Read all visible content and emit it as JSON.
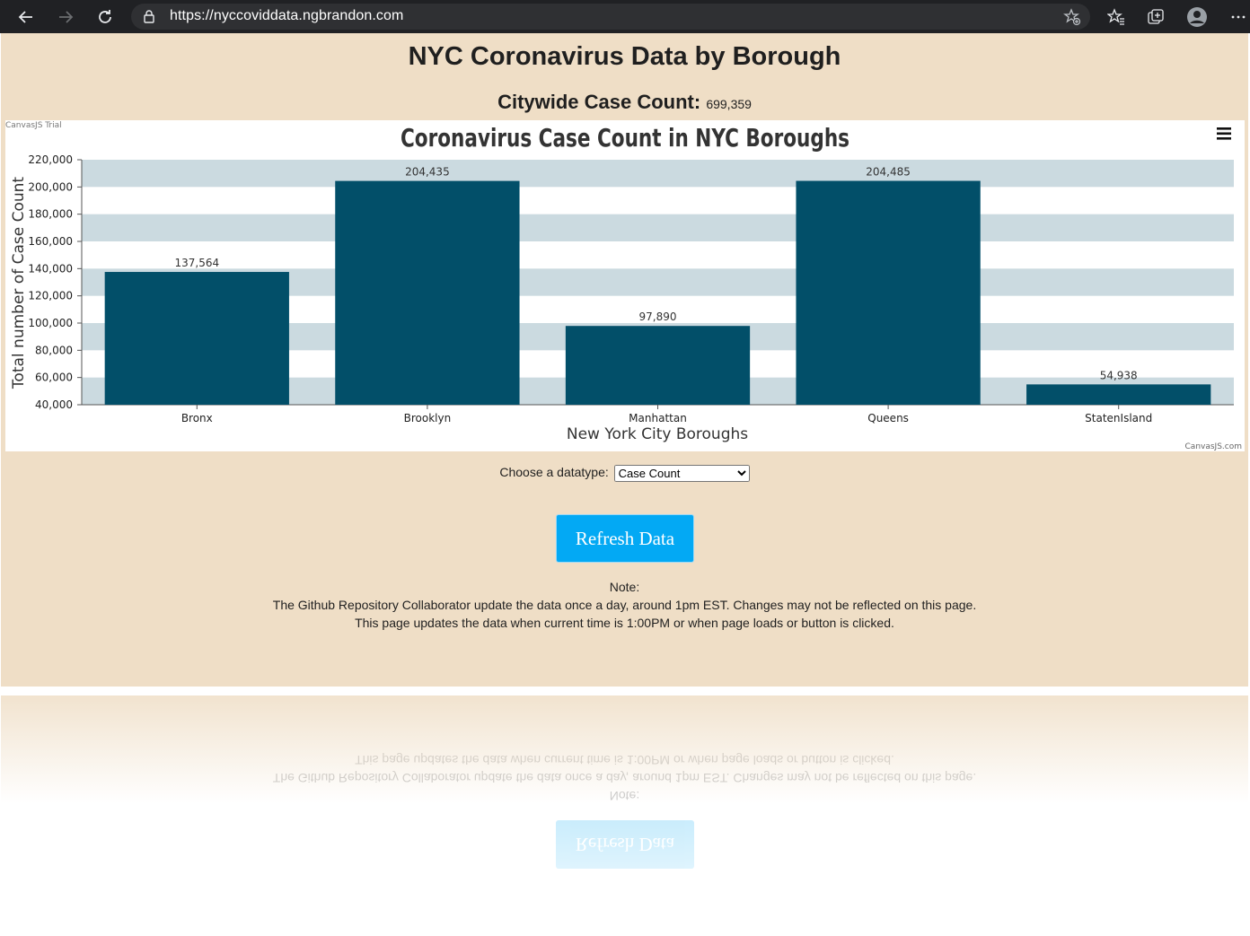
{
  "browser": {
    "url": "https://nyccoviddata.ngbrandon.com"
  },
  "page": {
    "title": "NYC Coronavirus Data by Borough",
    "citywide_label": "Citywide Case Count:",
    "citywide_value": "699,359",
    "datatype_label": "Choose a datatype:",
    "datatype_selected": "Case Count",
    "refresh_button": "Refresh Data",
    "note_heading": "Note:",
    "note_line1": "The Github Repository Collaborator update the data once a day, around 1pm EST. Changes may not be reflected on this page.",
    "note_line2": "This page updates the data when current time is 1:00PM or when page loads or button is clicked."
  },
  "chart_data": {
    "type": "bar",
    "title": "Coronavirus Case Count in NYC Boroughs",
    "xlabel": "New York City Boroughs",
    "ylabel": "Total number of Case Count",
    "categories": [
      "Bronx",
      "Brooklyn",
      "Manhattan",
      "Queens",
      "StatenIsland"
    ],
    "values": [
      137564,
      204435,
      97890,
      204485,
      54938
    ],
    "value_labels": [
      "137,564",
      "204,435",
      "97,890",
      "204,485",
      "54,938"
    ],
    "ylim": [
      40000,
      220000
    ],
    "yticks": [
      40000,
      60000,
      80000,
      100000,
      120000,
      140000,
      160000,
      180000,
      200000,
      220000
    ],
    "ytick_labels": [
      "40,000",
      "60,000",
      "80,000",
      "100,000",
      "120,000",
      "140,000",
      "160,000",
      "180,000",
      "200,000",
      "220,000"
    ],
    "grid": "alternating bands",
    "bar_color": "#024f69",
    "band_color": "#cbdae0",
    "trial_label": "CanvasJS Trial",
    "credit": "CanvasJS.com"
  },
  "colors": {
    "page_bg": "#efdec6",
    "button_bg": "#03a9f4",
    "chrome_bg": "#202124"
  }
}
